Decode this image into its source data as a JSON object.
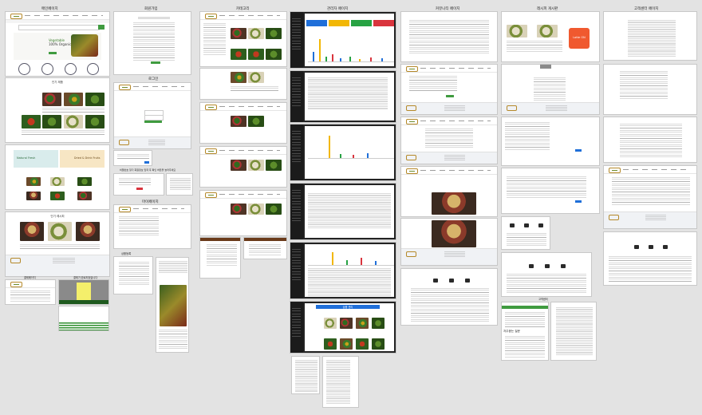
{
  "columns": {
    "main_page": "메인페이지",
    "signup": "회원가입",
    "category": "카테고리",
    "admin_page": "관리자 페이지",
    "community_page": "커뮤니티 페이지",
    "recipe_board": "레시피 게시판",
    "customer_center_page": "고객센터 페이지",
    "product_detail": "상품상세",
    "login": "로그인",
    "my_page": "마이페이지",
    "payment": "결제페이지",
    "product_register": "상품등록",
    "customer_center": "고객센터",
    "product_management": "상품 관리",
    "products_heading": "인기 제품",
    "popular_recipe": "인기 레시피",
    "inquiry_board": "자주묻는 질문",
    "hero_line1": "Vegetable",
    "hero_line2": "100% Organic",
    "pay_finish": "결제가 완료되었습니다",
    "login_notice": "비밀번호 찾기 회원정보 입력 후 확인 버튼을 눌러주세요"
  },
  "banners": {
    "fresh": "Natural Fresh",
    "drink": "Dried & Drink Fruits"
  },
  "recipe_badge": "Lotte ON",
  "colors": {
    "brand_gold": "#b5892a",
    "brand_green": "#3f9b3f",
    "admin_blue": "#1f6fd9",
    "admin_yellow": "#f2b705",
    "admin_green": "#27a243",
    "admin_red": "#d9343d",
    "recipe_orange": "#f0592f"
  }
}
